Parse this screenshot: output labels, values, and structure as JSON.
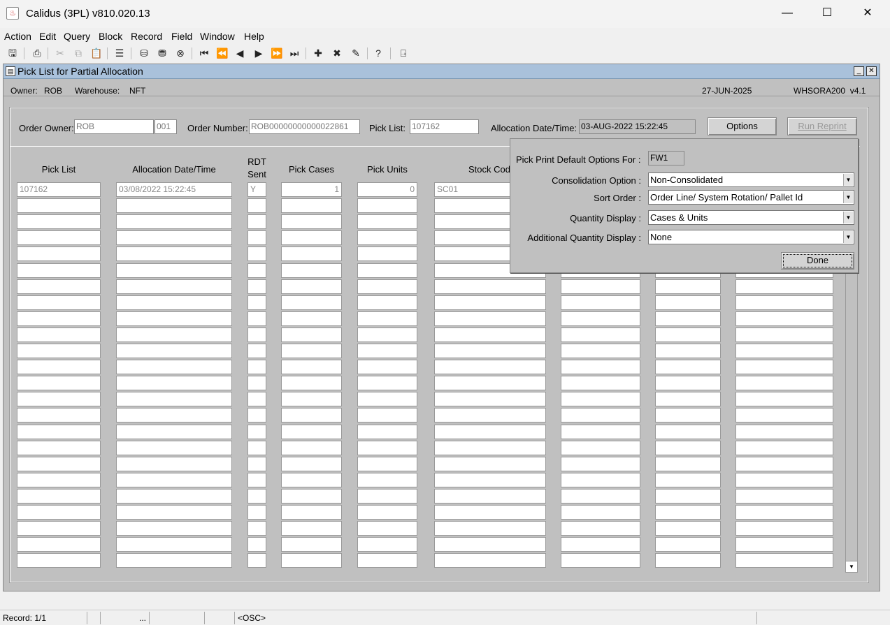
{
  "window": {
    "title": "Calidus (3PL) v810.020.13",
    "minimize": "—",
    "maximize": "☐",
    "close": "✕"
  },
  "menu": {
    "action": "Action",
    "edit": "Edit",
    "query": "Query",
    "block": "Block",
    "record": "Record",
    "field": "Field",
    "window": "Window",
    "help": "Help"
  },
  "form": {
    "title": "Pick List for Partial Allocation",
    "owner_label": "Owner:",
    "owner": "ROB",
    "warehouse_label": "Warehouse:",
    "warehouse": "NFT",
    "date": "27-JUN-2025",
    "module": "WHSORA200  v4.1"
  },
  "header": {
    "order_owner_label": "Order Owner:",
    "order_owner": "ROB",
    "order_owner_suffix": "001",
    "order_number_label": "Order Number:",
    "order_number": "ROB00000000000022861",
    "pick_list_label": "Pick List:",
    "pick_list": "107162",
    "alloc_label": "Allocation Date/Time:",
    "alloc": "03-AUG-2022 15:22:45",
    "options_button": "Options",
    "run_reprint_button": "Run Reprint"
  },
  "grid": {
    "columns": [
      "Pick List",
      "Allocation Date/Time",
      "RDT Sent",
      "Pick Cases",
      "Pick Units",
      "Stock Cod"
    ],
    "rdt_line1": "RDT",
    "rdt_line2": "Sent",
    "rows": [
      {
        "pick_list": "107162",
        "alloc": "03/08/2022 15:22:45",
        "rdt": "Y",
        "cases": "1",
        "units": "0",
        "stock": "SC01"
      }
    ]
  },
  "popup": {
    "default_for_label": "Pick Print Default Options For :",
    "default_for": "FW1",
    "consolidation_label": "Consolidation Option :",
    "consolidation": "Non-Consolidated",
    "sort_label": "Sort Order :",
    "sort": "Order Line/ System Rotation/ Pallet Id",
    "qty_label": "Quantity Display :",
    "qty": "Cases & Units",
    "addqty_label": "Additional Quantity Display :",
    "addqty": "None",
    "done_button": "Done"
  },
  "status": {
    "record": "Record: 1/1",
    "dots": "...",
    "osc": "<OSC>"
  }
}
